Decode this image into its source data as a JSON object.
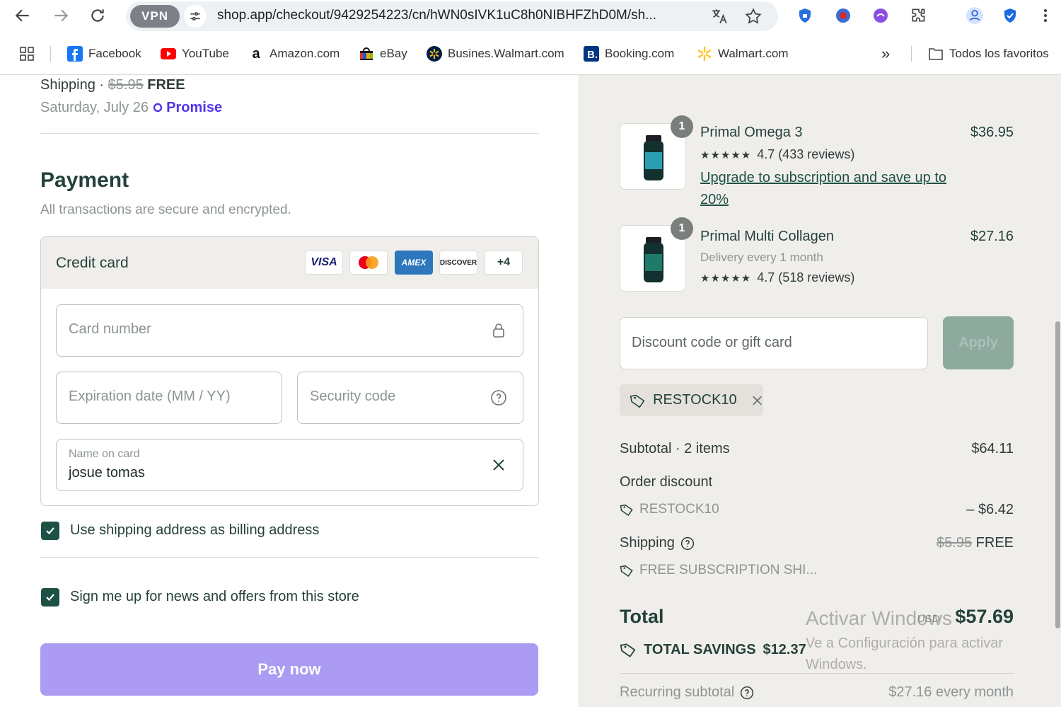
{
  "browser": {
    "vpn_label": "VPN",
    "url": "shop.app/checkout/9429254223/cn/hWN0sIVK1uC8h0NIBHFZhD0M/sh..."
  },
  "bookmarks": [
    {
      "label": "Facebook",
      "icon": "facebook-icon"
    },
    {
      "label": "YouTube",
      "icon": "youtube-icon"
    },
    {
      "label": "Amazon.com",
      "icon": "amazon-icon"
    },
    {
      "label": "eBay",
      "icon": "ebay-icon"
    },
    {
      "label": "Busines.Walmart.com",
      "icon": "walmart-business-icon"
    },
    {
      "label": "Booking.com",
      "icon": "booking-icon"
    },
    {
      "label": "Walmart.com",
      "icon": "walmart-icon"
    }
  ],
  "bookmarks_more": "»",
  "all_bookmarks": "Todos los favoritos",
  "shipping": {
    "label": "Shipping",
    "separator": "·",
    "old_price": "$5.95",
    "new_price": "FREE",
    "date": "Saturday, July 26",
    "promise": "Promise"
  },
  "payment": {
    "title": "Payment",
    "subtitle": "All transactions are secure and encrypted.",
    "method": "Credit card",
    "cards": [
      "VISA",
      "Mastercard",
      "AMEX",
      "DISCOVER"
    ],
    "more_cards": "+4",
    "card_number_placeholder": "Card number",
    "expiry_placeholder": "Expiration date (MM / YY)",
    "security_placeholder": "Security code",
    "name_label": "Name on card",
    "name_value": "josue tomas",
    "billing_checkbox": "Use shipping address as billing address",
    "news_checkbox": "Sign me up for news and offers from this store",
    "pay_button": "Pay now"
  },
  "products": [
    {
      "qty": "1",
      "name": "Primal Omega 3",
      "price": "$36.95",
      "stars": "★★★★★",
      "rating": "4.7 (433 reviews)",
      "upgrade": "Upgrade to subscription and save up to 20%"
    },
    {
      "qty": "1",
      "name": "Primal Multi Collagen",
      "price": "$27.16",
      "frequency": "Delivery every 1 month",
      "stars": "★★★★★",
      "rating": "4.7 (518 reviews)"
    }
  ],
  "discount": {
    "placeholder": "Discount code or gift card",
    "apply": "Apply",
    "applied_code": "RESTOCK10"
  },
  "summary": {
    "subtotal_label": "Subtotal · 2 items",
    "subtotal_value": "$64.11",
    "order_discount_label": "Order discount",
    "discount_code": "RESTOCK10",
    "discount_value": "– $6.42",
    "shipping_label": "Shipping",
    "shipping_old": "$5.95",
    "shipping_new": "FREE",
    "shipping_promo": "FREE SUBSCRIPTION SHI...",
    "total_label": "Total",
    "currency": "USD",
    "total_value": "$57.69",
    "savings_label": "TOTAL SAVINGS",
    "savings_value": "$12.37",
    "recurring_label": "Recurring subtotal",
    "recurring_value": "$27.16 every month"
  },
  "watermark": {
    "line1": "Activar Windows",
    "line2": "Ve a Configuración para activar Windows."
  },
  "colors": {
    "brand_green": "#1e5145",
    "pay_button": "#ab9bf2",
    "promise": "#5433eb",
    "summary_bg": "#f0eeeb"
  }
}
